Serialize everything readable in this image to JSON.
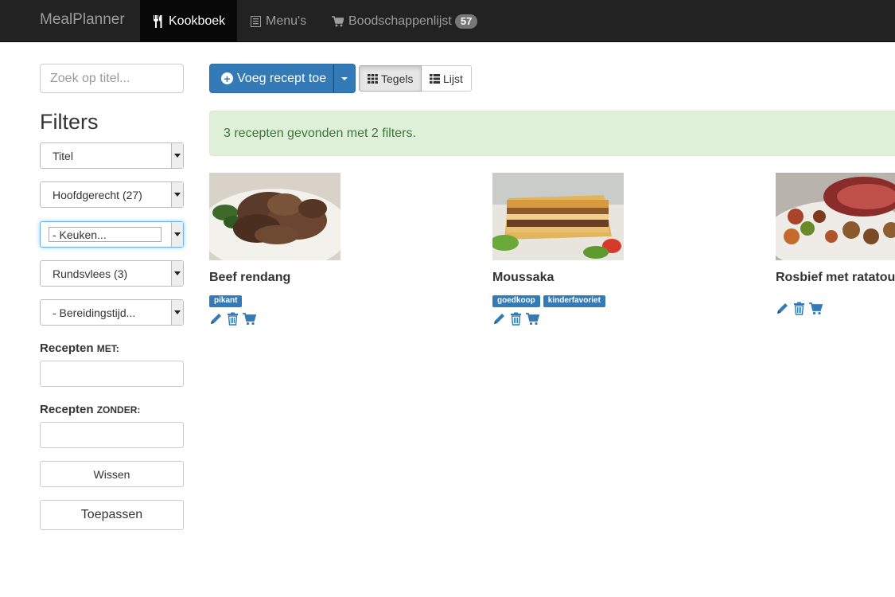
{
  "navbar": {
    "brand": "MealPlanner",
    "items": [
      {
        "label": "Kookboek",
        "icon": "cutlery-icon",
        "active": true
      },
      {
        "label": "Menu's",
        "icon": "list-icon"
      },
      {
        "label": "Boodschappenlijst",
        "icon": "shopping-cart-icon",
        "badge": "57"
      }
    ]
  },
  "sidebar": {
    "search_placeholder": "Zoek op titel...",
    "filters_title": "Filters",
    "selects": [
      "Titel",
      "Hoofdgerecht (27)",
      "- Keuken...",
      "Rundsvlees (3)",
      "- Bereidingstijd..."
    ],
    "with_label": "Recepten",
    "with_suffix": "met:",
    "without_label": "Recepten",
    "without_suffix": "zonder:",
    "clear_button": "Wissen",
    "apply_button": "Toepassen"
  },
  "toolbar": {
    "add_button": "Voeg recept toe",
    "view_tiles": "Tegels",
    "view_list": "Lijst"
  },
  "alert": "3 recepten gevonden met 2 filters.",
  "recipes": [
    {
      "title": "Beef rendang",
      "tags": [
        "pikant"
      ]
    },
    {
      "title": "Moussaka",
      "tags": [
        "goedkoop",
        "kinderfavoriet"
      ]
    },
    {
      "title": "Rosbief met ratatouille",
      "tags": []
    }
  ],
  "colors": {
    "navbar": "#222222",
    "primary": "#337ab7",
    "alert_bg": "#dff0d8",
    "alert_text": "#3c763d"
  }
}
